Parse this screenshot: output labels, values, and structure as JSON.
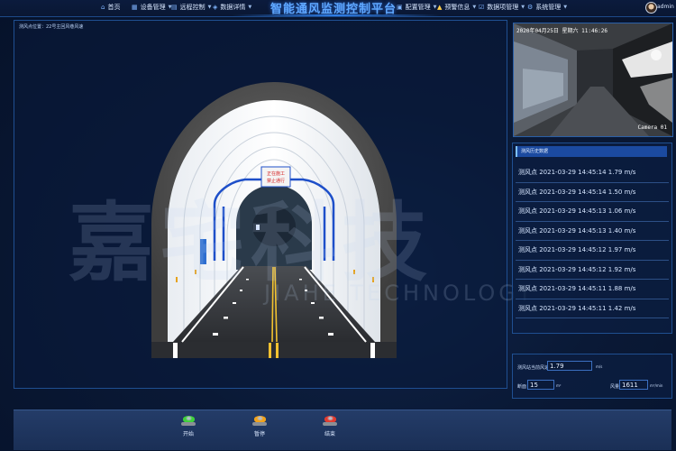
{
  "header": {
    "title": "智能通风监测控制平台",
    "nav_left": [
      {
        "label": "首页",
        "icon": "home-icon",
        "dropdown": false
      },
      {
        "label": "设备管理",
        "icon": "device-icon",
        "dropdown": true
      },
      {
        "label": "远程控制",
        "icon": "remote-icon",
        "dropdown": true
      },
      {
        "label": "数据详情",
        "icon": "data-icon",
        "dropdown": true
      }
    ],
    "nav_right": [
      {
        "label": "配置管理",
        "icon": "config-icon",
        "dropdown": true
      },
      {
        "label": "预警信息",
        "icon": "alert-icon",
        "dropdown": true
      },
      {
        "label": "数据项管理",
        "icon": "data-item-icon",
        "dropdown": true
      },
      {
        "label": "系统管理",
        "icon": "system-icon",
        "dropdown": true
      }
    ],
    "user": "admin"
  },
  "main": {
    "caption": "测风点位置：22号主回风巷风速",
    "watermark_cn": "嘉宅科技",
    "watermark_en": "JIAHE TECHNOLOGY"
  },
  "camera": {
    "timestamp": "2020年04月25日  星期六  11:46:26",
    "label": "Camera 01"
  },
  "records": {
    "title": "测风历史数据",
    "items": [
      "测风点 2021-03-29 14:45:14 1.79 m/s",
      "测风点 2021-03-29 14:45:14 1.50 m/s",
      "测风点 2021-03-29 14:45:13 1.06 m/s",
      "测风点 2021-03-29 14:45:13 1.40 m/s",
      "测风点 2021-03-29 14:45:12 1.97 m/s",
      "测风点 2021-03-29 14:45:12 1.92 m/s",
      "测风点 2021-03-29 14:45:11 1.88 m/s",
      "测风点 2021-03-29 14:45:11 1.42 m/s"
    ]
  },
  "params": {
    "speed_label": "测风站当前风速",
    "speed_value": "1.79",
    "speed_unit": "m/s",
    "area_label": "断面",
    "area_value": "15",
    "area_unit": "m²",
    "volume_label": "风量",
    "volume_value": "1611",
    "volume_unit": "m³/min"
  },
  "controls": {
    "start_label": "开始",
    "pause_label": "暂停",
    "stop_label": "结束",
    "start_color": "#3fd13a",
    "pause_color": "#f2a21a",
    "stop_color": "#e23b2e"
  },
  "tunnel": {
    "sign_line1": "正在施工",
    "sign_line2": "禁止通行"
  }
}
